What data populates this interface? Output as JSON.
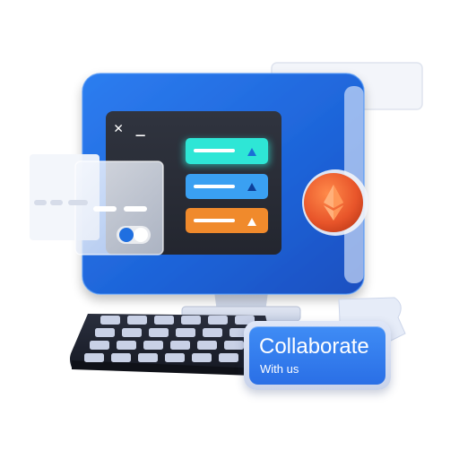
{
  "terminal": {
    "prompt": "✕ _"
  },
  "menu_items": [
    {
      "color": "#2ee6d6",
      "icon": "triangle-up-icon"
    },
    {
      "color": "#3aa0f2",
      "icon": "triangle-up-icon"
    },
    {
      "color": "#f08a2c",
      "icon": "triangle-up-icon"
    }
  ],
  "coin": {
    "icon": "ethereum-icon",
    "color": "#e8552a"
  },
  "badge": {
    "title": "Collaborate",
    "subtitle": "With us"
  },
  "colors": {
    "monitor": "#1f6fe0",
    "screen": "#2b2f3a",
    "keyboard": "#1e2230",
    "keys": "#c9d1e6"
  }
}
